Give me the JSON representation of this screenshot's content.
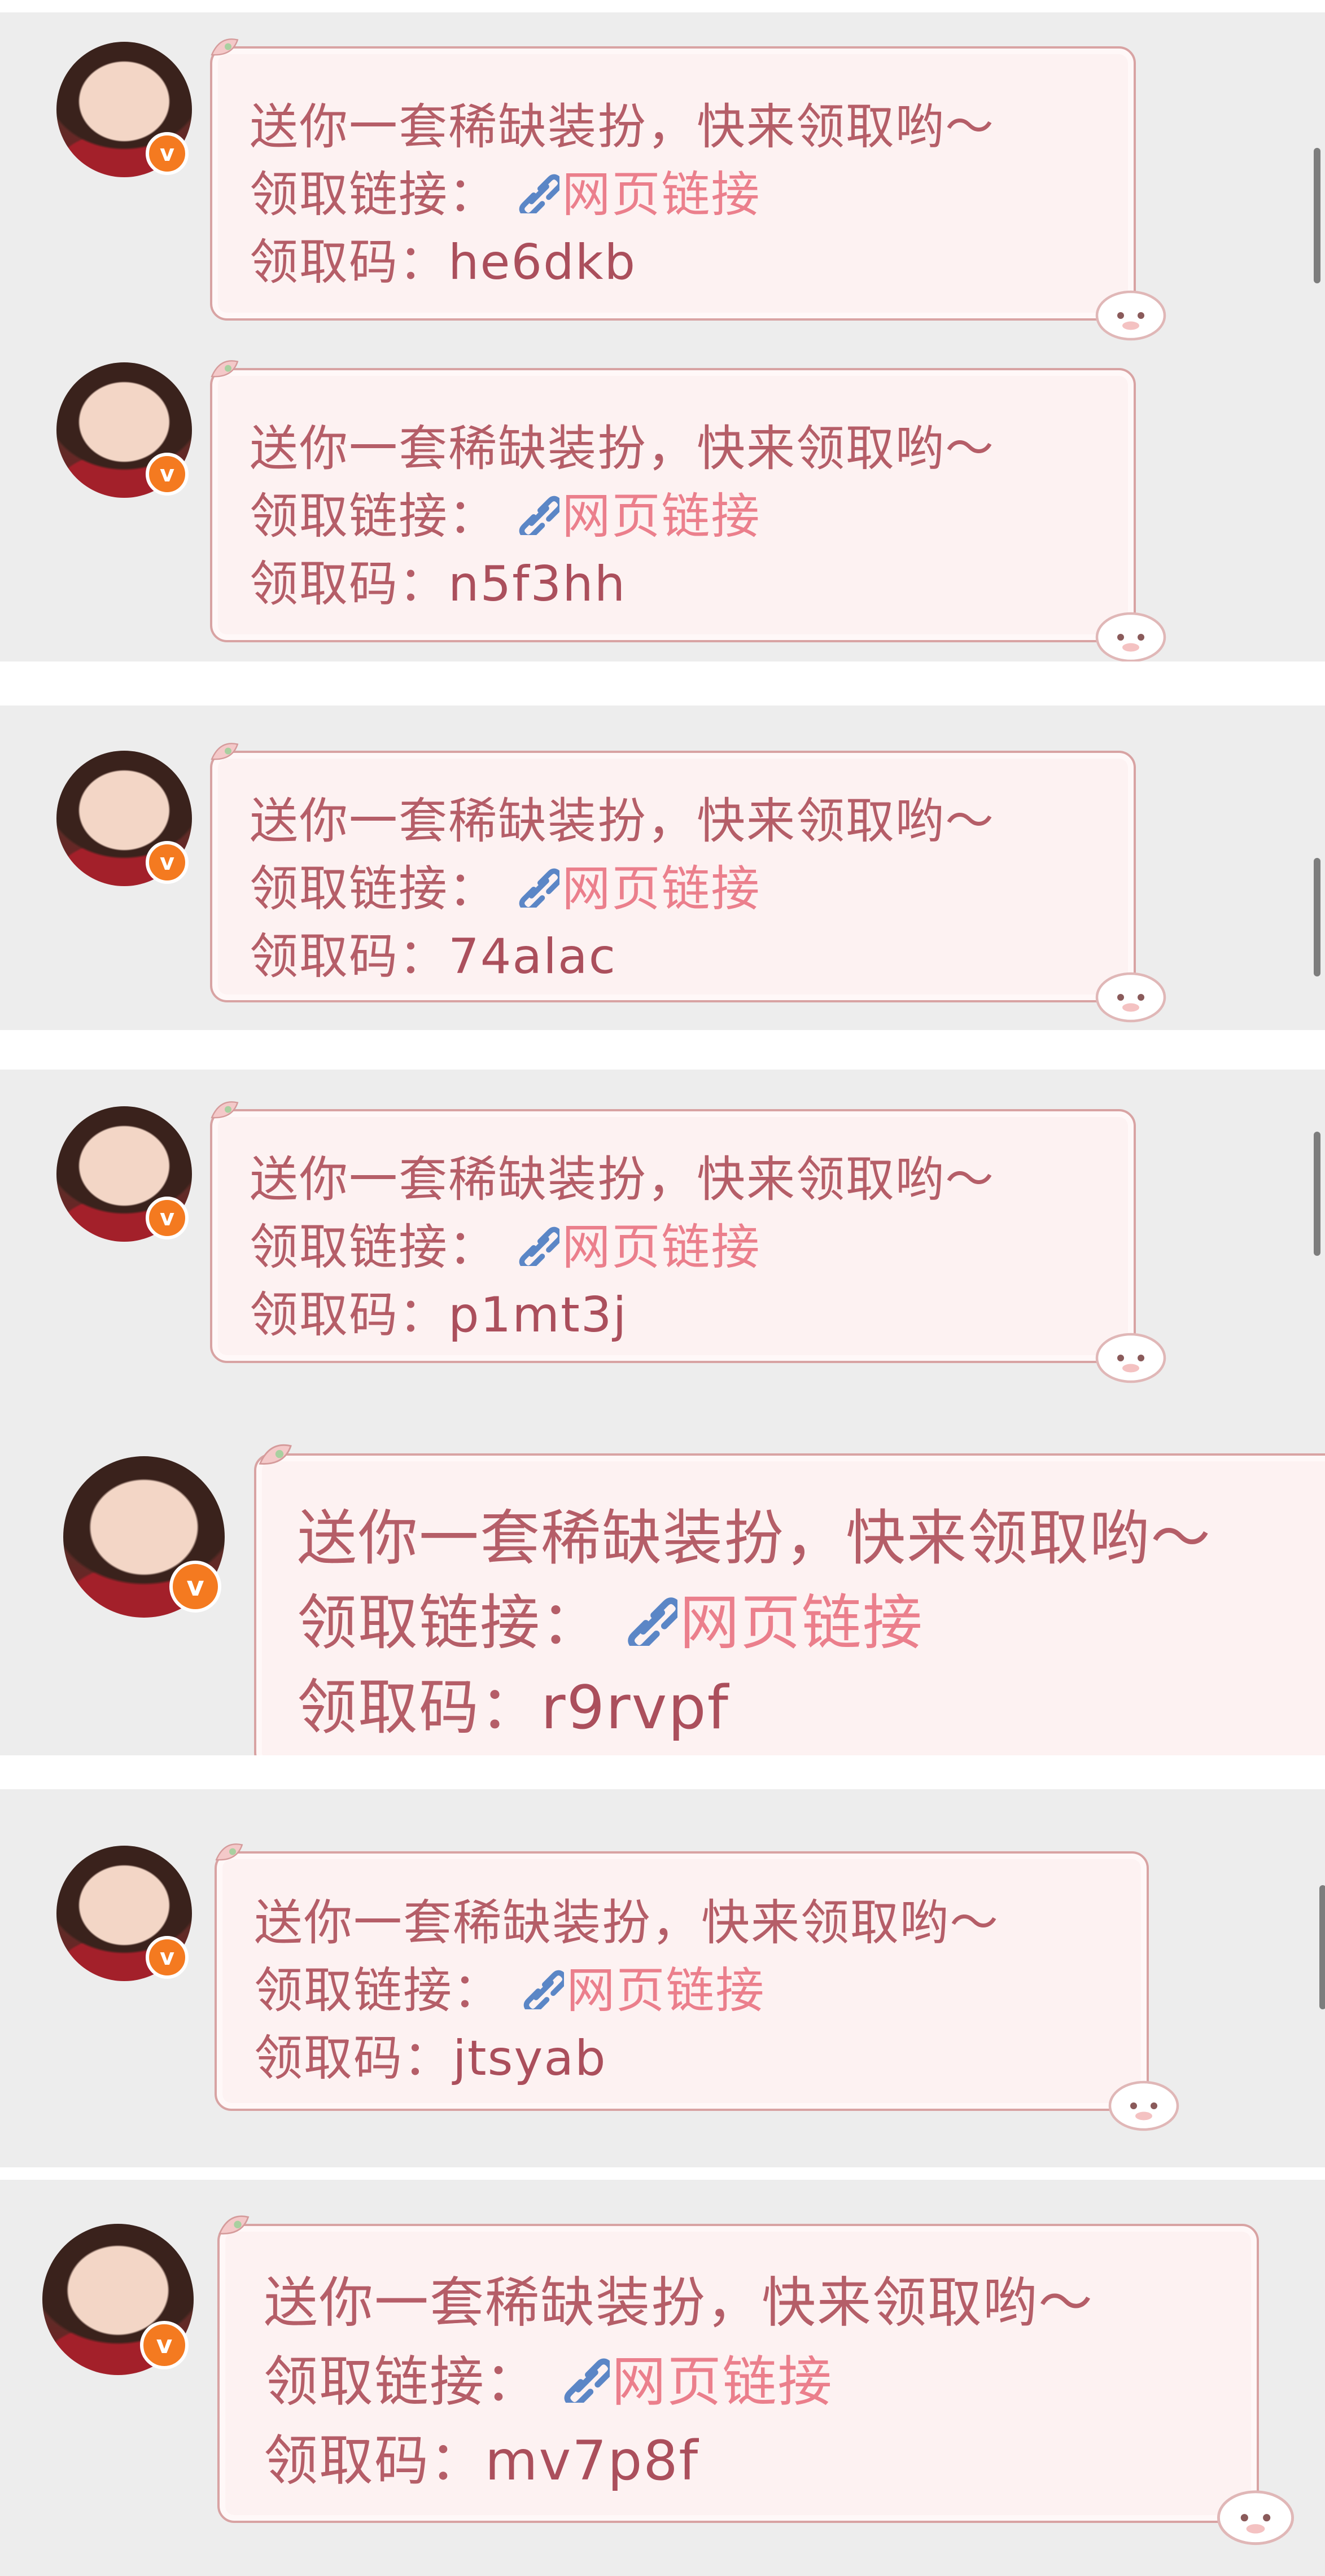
{
  "messages": [
    {
      "greeting": "送你一套稀缺装扮，快来领取哟～",
      "link_prefix": "领取链接：",
      "link_text": "网页链接",
      "code_prefix": "领取码：",
      "code": "he6dkb"
    },
    {
      "greeting": "送你一套稀缺装扮，快来领取哟～",
      "link_prefix": "领取链接：",
      "link_text": "网页链接",
      "code_prefix": "领取码：",
      "code": "n5f3hh"
    },
    {
      "greeting": "送你一套稀缺装扮，快来领取哟～",
      "link_prefix": "领取链接：",
      "link_text": "网页链接",
      "code_prefix": "领取码：",
      "code": "74alac"
    },
    {
      "greeting": "送你一套稀缺装扮，快来领取哟～",
      "link_prefix": "领取链接：",
      "link_text": "网页链接",
      "code_prefix": "领取码：",
      "code": "p1mt3j"
    },
    {
      "greeting": "送你一套稀缺装扮，快来领取哟～",
      "link_prefix": "领取链接：",
      "link_text": "网页链接",
      "code_prefix": "领取码：",
      "code": "r9rvpf"
    },
    {
      "greeting": "送你一套稀缺装扮，快来领取哟～",
      "link_prefix": "领取链接：",
      "link_text": "网页链接",
      "code_prefix": "领取码：",
      "code": "jtsyab"
    },
    {
      "greeting": "送你一套稀缺装扮，快来领取哟～",
      "link_prefix": "领取链接：",
      "link_text": "网页链接",
      "code_prefix": "领取码：",
      "code": "mv7p8f"
    }
  ],
  "avatar_badge": "v",
  "colors": {
    "background": "#ededed",
    "bubble_fill": "#fdf2f2",
    "bubble_border": "#d8a3a3",
    "text": "#b55e68",
    "link": "#eb7f8c",
    "link_icon": "#5b86c6",
    "badge": "#f47a20"
  },
  "icons": {
    "link": "link-icon",
    "verified": "verified-badge-icon",
    "sticker": "lamb-sticker-icon"
  }
}
